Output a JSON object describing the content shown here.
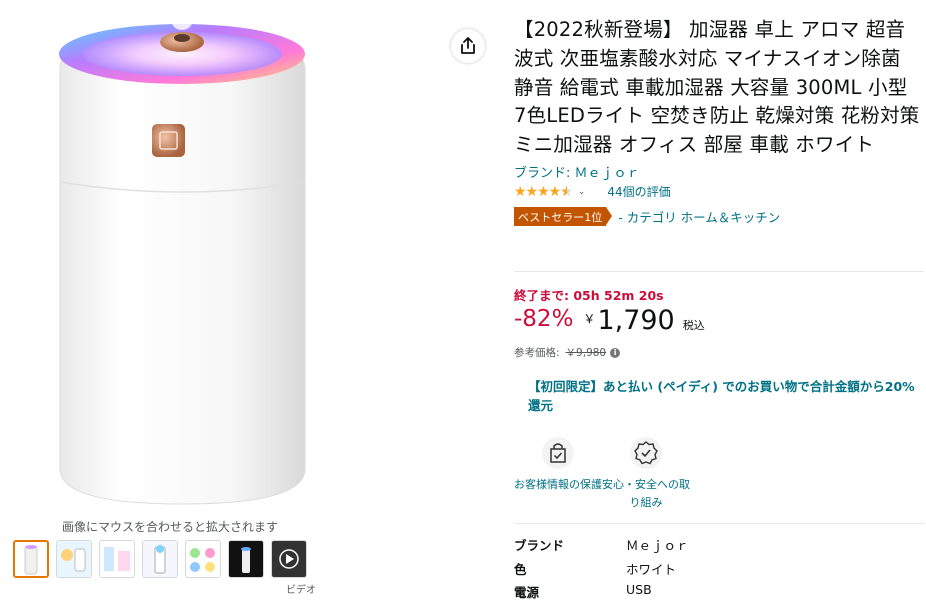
{
  "gallery": {
    "hover_hint": "画像にマウスを合わせると拡大されます",
    "video_label": "ビデオ",
    "thumbnail_count": 7
  },
  "product": {
    "title": "【2022秋新登場】 加湿器 卓上 アロマ 超音波式 次亜塩素酸水対応 マイナスイオン除菌 静音 給電式 車載加湿器 大容量 300ML 小型 7色LEDライト 空焚き防止 乾燥対策 花粉対策 ミニ加湿器 オフィス 部屋 車載 ホワイト",
    "brand_link": "ブランド: Ｍｅｊｏｒ",
    "rating_stars": 4.5,
    "review_count": "44個の評価",
    "bestseller_badge": "ベストセラー1位",
    "bestseller_category": "- カテゴリ ホーム＆キッチン"
  },
  "deal": {
    "timer": "終了まで: 05h 52m 20s",
    "discount": "-82%",
    "currency": "￥",
    "price": "1,790",
    "tax_label": "税込",
    "list_price_label": "参考価格:",
    "list_price": "￥9,980"
  },
  "promo": {
    "text": "【初回限定】あと払い (ペイディ) でのお買い物で合計金額から20%還元"
  },
  "features": [
    {
      "icon": "shopping-bag-check-icon",
      "label": "お客様情報の保護"
    },
    {
      "icon": "shield-badge-icon",
      "label": "安心・安全への取り組み"
    }
  ],
  "specs": [
    {
      "key": "ブランド",
      "value": "Ｍｅｊｏｒ"
    },
    {
      "key": "色",
      "value": "ホワイト"
    },
    {
      "key": "電源",
      "value": "USB"
    }
  ],
  "colors": {
    "link": "#007185",
    "deal_red": "#cc0c39",
    "badge_orange": "#c45500",
    "star": "#ffa41c"
  }
}
